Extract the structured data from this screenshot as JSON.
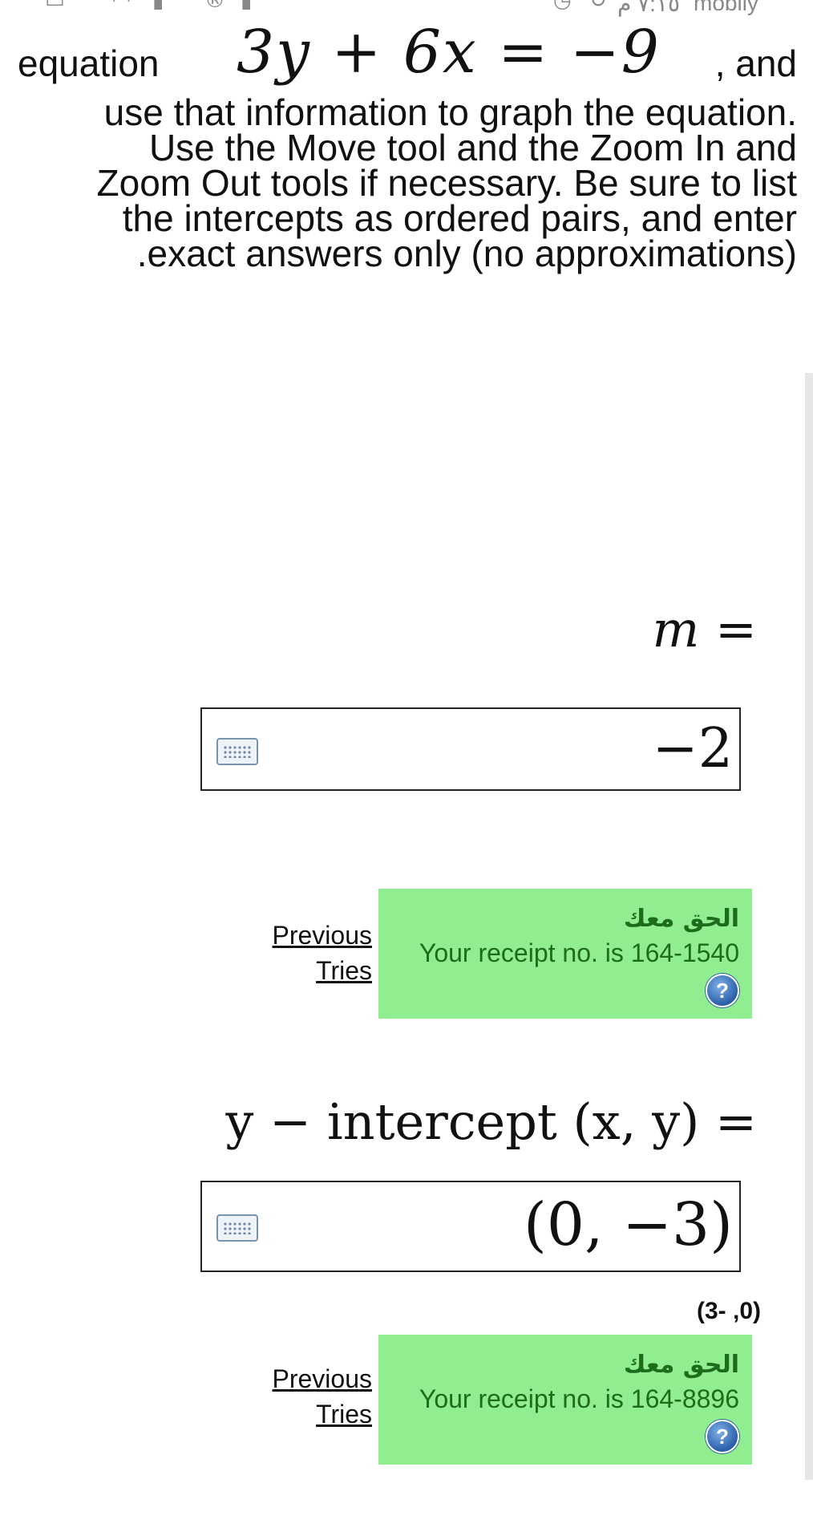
{
  "status_bar": {
    "carrier": "mobily",
    "time": "٧:١٥ م"
  },
  "instructions": {
    "word_equation": "equation",
    "equation": "3y + 6x = −9",
    "and": ", and",
    "lines": [
      "use that information to graph the equation.",
      "Use the Move tool and the Zoom In and",
      "Zoom Out tools if necessary. Be sure to list",
      "the intercepts as ordered pairs, and enter",
      ".exact answers only (no approximations)"
    ]
  },
  "slope": {
    "label": "m =",
    "value": "−2",
    "previous_tries": [
      "Previous",
      "Tries"
    ],
    "feedback_arabic": "الحق معك",
    "receipt": "Your receipt no. is 164-1540",
    "help_symbol": "?"
  },
  "y_intercept": {
    "label": "y − intercept (x, y) =",
    "value": "(0, −3)",
    "preview": "(3- ,0)",
    "previous_tries": [
      "Previous",
      "Tries"
    ],
    "feedback_arabic": "الحق معك",
    "receipt": "Your receipt no. is 164-8896",
    "help_symbol": "?"
  },
  "colors": {
    "feedback_bg": "#90ee90",
    "feedback_text": "#1d6b1d",
    "help_icon": "#2a5fa8"
  }
}
